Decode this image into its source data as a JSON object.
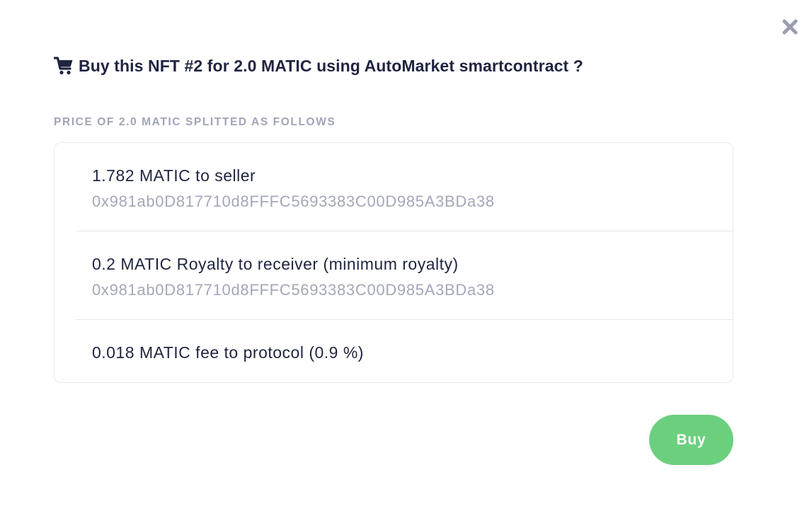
{
  "modal": {
    "title": "Buy this NFT #2 for 2.0 MATIC using AutoMarket smartcontract ?",
    "section_label": "PRICE OF 2.0 MATIC SPLITTED AS FOLLOWS",
    "splits": [
      {
        "amount_text": "1.782 MATIC to seller",
        "address": "0x981ab0D817710d8FFFC5693383C00D985A3BDa38"
      },
      {
        "amount_text": "0.2 MATIC Royalty to receiver (minimum royalty)",
        "address": "0x981ab0D817710d8FFFC5693383C00D985A3BDa38"
      },
      {
        "amount_text": "0.018 MATIC fee to protocol (0.9 %)"
      }
    ],
    "buy_label": "Buy",
    "icons": {
      "title": "shopping-cart-icon",
      "close": "close-icon"
    },
    "colors": {
      "accent": "#6ccf7e",
      "text": "#1f2440",
      "muted": "#a1a4b6"
    }
  }
}
